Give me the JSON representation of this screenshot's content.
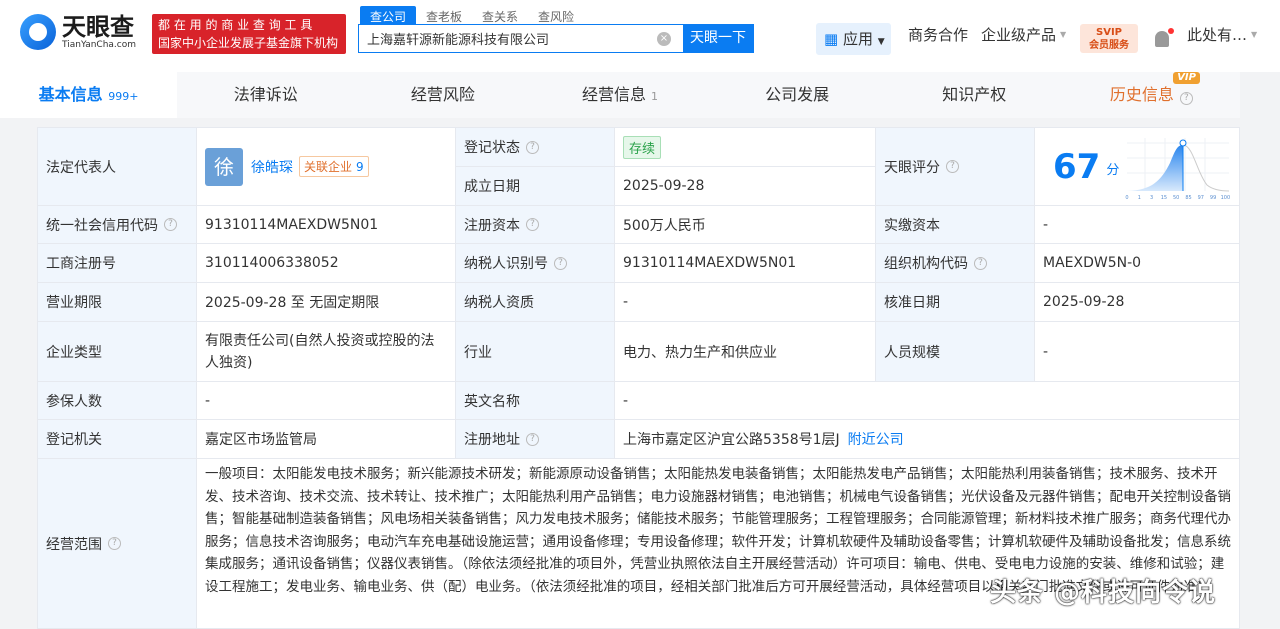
{
  "header": {
    "logo_cn": "天眼查",
    "logo_en": "TianYanCha.com",
    "slogan_1": "都 在 用 的 商 业 查 询 工 具",
    "slogan_2": "国家中小企业发展子基金旗下机构",
    "search_tabs": [
      "查公司",
      "查老板",
      "查关系",
      "查风险"
    ],
    "search_value": "上海嘉轩源新能源科技有限公司",
    "search_button": "天眼一下",
    "apps": "应用",
    "biz": "商务合作",
    "enterprise": "企业级产品",
    "swip_1": "SVIP",
    "swip_2": "会员服务",
    "user": "此处有…"
  },
  "tabs": [
    {
      "label": "基本信息",
      "count": "999+"
    },
    {
      "label": "法律诉讼"
    },
    {
      "label": "经营风险"
    },
    {
      "label": "经营信息",
      "count": "1"
    },
    {
      "label": "公司发展"
    },
    {
      "label": "知识产权"
    },
    {
      "label": "历史信息",
      "vip": "VIP"
    }
  ],
  "info": {
    "legal_rep_label": "法定代表人",
    "legal_rep_avatar": "徐",
    "legal_rep": "徐皓琛",
    "related_label": "关联企业",
    "related_count": "9",
    "reg_status_label": "登记状态",
    "reg_status": "存续",
    "found_label": "成立日期",
    "found": "2025-09-28",
    "score_label": "天眼评分",
    "score": "67",
    "score_unit": "分",
    "score_ticks": [
      "0",
      "1",
      "3",
      "15",
      "50",
      "85",
      "97",
      "99",
      "100"
    ],
    "credit_label": "统一社会信用代码",
    "credit": "91310114MAEXDW5N01",
    "capital_label": "注册资本",
    "capital": "500万人民币",
    "paid_label": "实缴资本",
    "paid": "-",
    "regno_label": "工商注册号",
    "regno": "310114006338052",
    "taxid_label": "纳税人识别号",
    "taxid": "91310114MAEXDW5N01",
    "org_label": "组织机构代码",
    "org": "MAEXDW5N-0",
    "term_label": "营业期限",
    "term": "2025-09-28 至 无固定期限",
    "taxq_label": "纳税人资质",
    "taxq": "-",
    "approve_label": "核准日期",
    "approve": "2025-09-28",
    "type_label": "企业类型",
    "type": "有限责任公司(自然人投资或控股的法人独资)",
    "industry_label": "行业",
    "industry": "电力、热力生产和供应业",
    "staff_label": "人员规模",
    "staff": "-",
    "insured_label": "参保人数",
    "insured": "-",
    "en_label": "英文名称",
    "en": "-",
    "authority_label": "登记机关",
    "authority": "嘉定区市场监管局",
    "addr_label": "注册地址",
    "addr": "上海市嘉定区沪宜公路5358号1层J",
    "nearby": "附近公司",
    "scope_label": "经营范围",
    "scope": "一般项目：太阳能发电技术服务；新兴能源技术研发；新能源原动设备销售；太阳能热发电装备销售；太阳能热发电产品销售；太阳能热利用装备销售；技术服务、技术开发、技术咨询、技术交流、技术转让、技术推广；太阳能热利用产品销售；电力设施器材销售；电池销售；机械电气设备销售；光伏设备及元器件销售；配电开关控制设备销售；智能基础制造装备销售；风电场相关装备销售；风力发电技术服务；储能技术服务；节能管理服务；工程管理服务；合同能源管理；新材料技术推广服务；商务代理代办服务；信息技术咨询服务；电动汽车充电基础设施运营；通用设备修理；专用设备修理；软件开发；计算机软硬件及辅助设备零售；计算机软硬件及辅助设备批发；信息系统集成服务；通讯设备销售；仪器仪表销售。（除依法须经批准的项目外，凭营业执照依法自主开展经营活动）许可项目：输电、供电、受电电力设施的安装、维修和试验；建设工程施工；发电业务、输电业务、供（配）电业务。（依法须经批准的项目，经相关部门批准后方可开展经营活动，具体经营项目以相关部门批准文件或许可证件为准)"
  },
  "watermark": "头条 @科技向令说"
}
